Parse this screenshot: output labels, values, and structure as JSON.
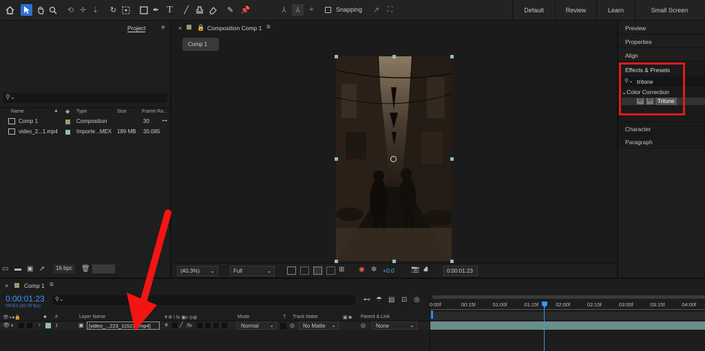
{
  "toolbar": {
    "snapping_label": "Snapping",
    "workspaces": [
      "Default",
      "Review",
      "Learn",
      "Small Screen"
    ]
  },
  "project": {
    "tab_label": "Project",
    "search_placeholder": "",
    "columns": [
      "Name",
      "Type",
      "Size",
      "Frame Ra..."
    ],
    "items": [
      {
        "name": "Comp 1",
        "type": "Composition",
        "size": "",
        "fps": "30",
        "icon": "composition-icon",
        "swatch": "#a39570"
      },
      {
        "name": "video_2...1.mp4",
        "type": "Importe...MEX",
        "size": "189 MB",
        "fps": "30.085",
        "icon": "video-file-icon",
        "swatch": "#8fbcb8"
      }
    ],
    "bpc_label": "16 bpc"
  },
  "comp_panel": {
    "title": "Composition Comp 1",
    "comp_chip": "Comp 1",
    "zoom": "(40.3%)",
    "resolution": "Full",
    "exposure": "+0.0",
    "timecode": "0:00:01:23"
  },
  "right_panel": {
    "items": [
      "Preview",
      "Properties",
      "Align"
    ],
    "effects_title": "Effects & Presets",
    "search_value": "tritone",
    "category": "Color Correction",
    "effect": "Tritone",
    "bottom_items": [
      "Character",
      "Paragraph"
    ],
    "highlight_color": "#e01b1b"
  },
  "timeline": {
    "comp_tab": "Comp 1",
    "timecode": "0:00:01:23",
    "frame_info": "00053 (30.00 fps)",
    "headers": {
      "num": "#",
      "layer_name": "Layer Name",
      "mode": "Mode",
      "t": "T",
      "track_matte": "Track Matte",
      "parent": "Parent & Link"
    },
    "ruler_ticks": [
      "0:00f",
      "00:15f",
      "01:00f",
      "01:15f",
      "02:00f",
      "02:15f",
      "03:00f",
      "03:15f",
      "04:00f"
    ],
    "layer": {
      "number": "1",
      "name": "[video_...223_115211.mp4]",
      "mode": "Normal",
      "track_matte": "No Matte",
      "parent": "None"
    },
    "accent_color": "#2b8cff",
    "arrow_color": "#f41414"
  }
}
